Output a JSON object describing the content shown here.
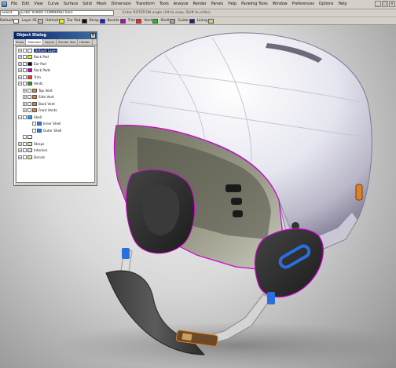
{
  "menubar": {
    "items": [
      "File",
      "Edit",
      "View",
      "Curve",
      "Surface",
      "Solid",
      "Mesh",
      "Dimension",
      "Transform",
      "Tools",
      "Analyze",
      "Render",
      "Panels",
      "Help",
      "Paneling Tools",
      "Window",
      "Preferences",
      "Options",
      "Help"
    ]
  },
  "toolbar": {
    "command_label": "Select",
    "command_value": "Enter RHINO COMMAND here",
    "prompt_text": "Enter ROTATION angle (Alt to snap, Shift to ortho)"
  },
  "layerbar": {
    "items": [
      {
        "label": "Default",
        "color": "#ffffff"
      },
      {
        "label": "Layer 01",
        "color": "#c0c0c0"
      },
      {
        "label": "Helmet",
        "color": "#f2f200"
      },
      {
        "label": "Ear Pad",
        "color": "#101010"
      },
      {
        "label": "Strap",
        "color": "#1a1aff"
      },
      {
        "label": "Buckle",
        "color": "#c000c0"
      },
      {
        "label": "Trim",
        "color": "#ff2020"
      },
      {
        "label": "Vent",
        "color": "#1ac01a"
      },
      {
        "label": "Shell",
        "color": "#a0a0a0"
      },
      {
        "label": "Guide",
        "color": "#202080"
      },
      {
        "label": "Lining",
        "color": "#d0d080"
      }
    ]
  },
  "object_dialog": {
    "title": "Object Dialog",
    "close": "×",
    "tabs": [
      "Show",
      "Selected",
      "Layers",
      "Render Mat",
      "Hidden"
    ],
    "rows": [
      {
        "indent": 0,
        "exp": "+",
        "label": "Default Layer",
        "color": "#ffffff",
        "selected": true
      },
      {
        "indent": 0,
        "exp": "+",
        "label": "Rock Pad",
        "color": "#f0f000",
        "selected": false
      },
      {
        "indent": 0,
        "exp": "+",
        "label": "Ear Pad",
        "color": "#101010",
        "selected": false
      },
      {
        "indent": 0,
        "exp": "+",
        "label": "Rock Pads",
        "color": "#c000c0",
        "selected": false
      },
      {
        "indent": 0,
        "exp": "+",
        "label": "Trim",
        "color": "#ff3030",
        "selected": false
      },
      {
        "indent": 0,
        "exp": "−",
        "label": "Vents",
        "color": "#20a020",
        "selected": false
      },
      {
        "indent": 1,
        "exp": "+",
        "label": "Top Vent",
        "color": "#ff7a00",
        "selected": false
      },
      {
        "indent": 1,
        "exp": "+",
        "label": "Side Vent",
        "color": "#ff7a00",
        "selected": false
      },
      {
        "indent": 1,
        "exp": "+",
        "label": "Back Vent",
        "color": "#ff7a00",
        "selected": false
      },
      {
        "indent": 1,
        "exp": "+",
        "label": "Front Vents",
        "color": "#ff7a00",
        "selected": false
      },
      {
        "indent": 0,
        "exp": "−",
        "label": "Shell",
        "color": "#20a0ff",
        "selected": false
      },
      {
        "indent": 2,
        "exp": "",
        "label": "Inner Shell",
        "color": "#2080ff",
        "selected": false
      },
      {
        "indent": 2,
        "exp": "",
        "label": "Outer Shell",
        "color": "#2080ff",
        "selected": false
      },
      {
        "indent": 0,
        "exp": "",
        "label": "",
        "color": "#ffffff",
        "selected": false
      },
      {
        "indent": 0,
        "exp": "+",
        "label": "Straps",
        "color": "#e8e8a0",
        "selected": false
      },
      {
        "indent": 0,
        "exp": "+",
        "label": "Interiors",
        "color": "#e8e8e8",
        "selected": false
      },
      {
        "indent": 0,
        "exp": "+",
        "label": "Decals",
        "color": "#e8e8a0",
        "selected": false
      }
    ]
  },
  "colors": {
    "title_bar": "#0a246a",
    "shell": "#f0f0f6",
    "ear_pad": "#2b2b2b",
    "highlight": "#d000d0",
    "accent_blue": "#2a6ee0",
    "accent_orange": "#e08020"
  }
}
